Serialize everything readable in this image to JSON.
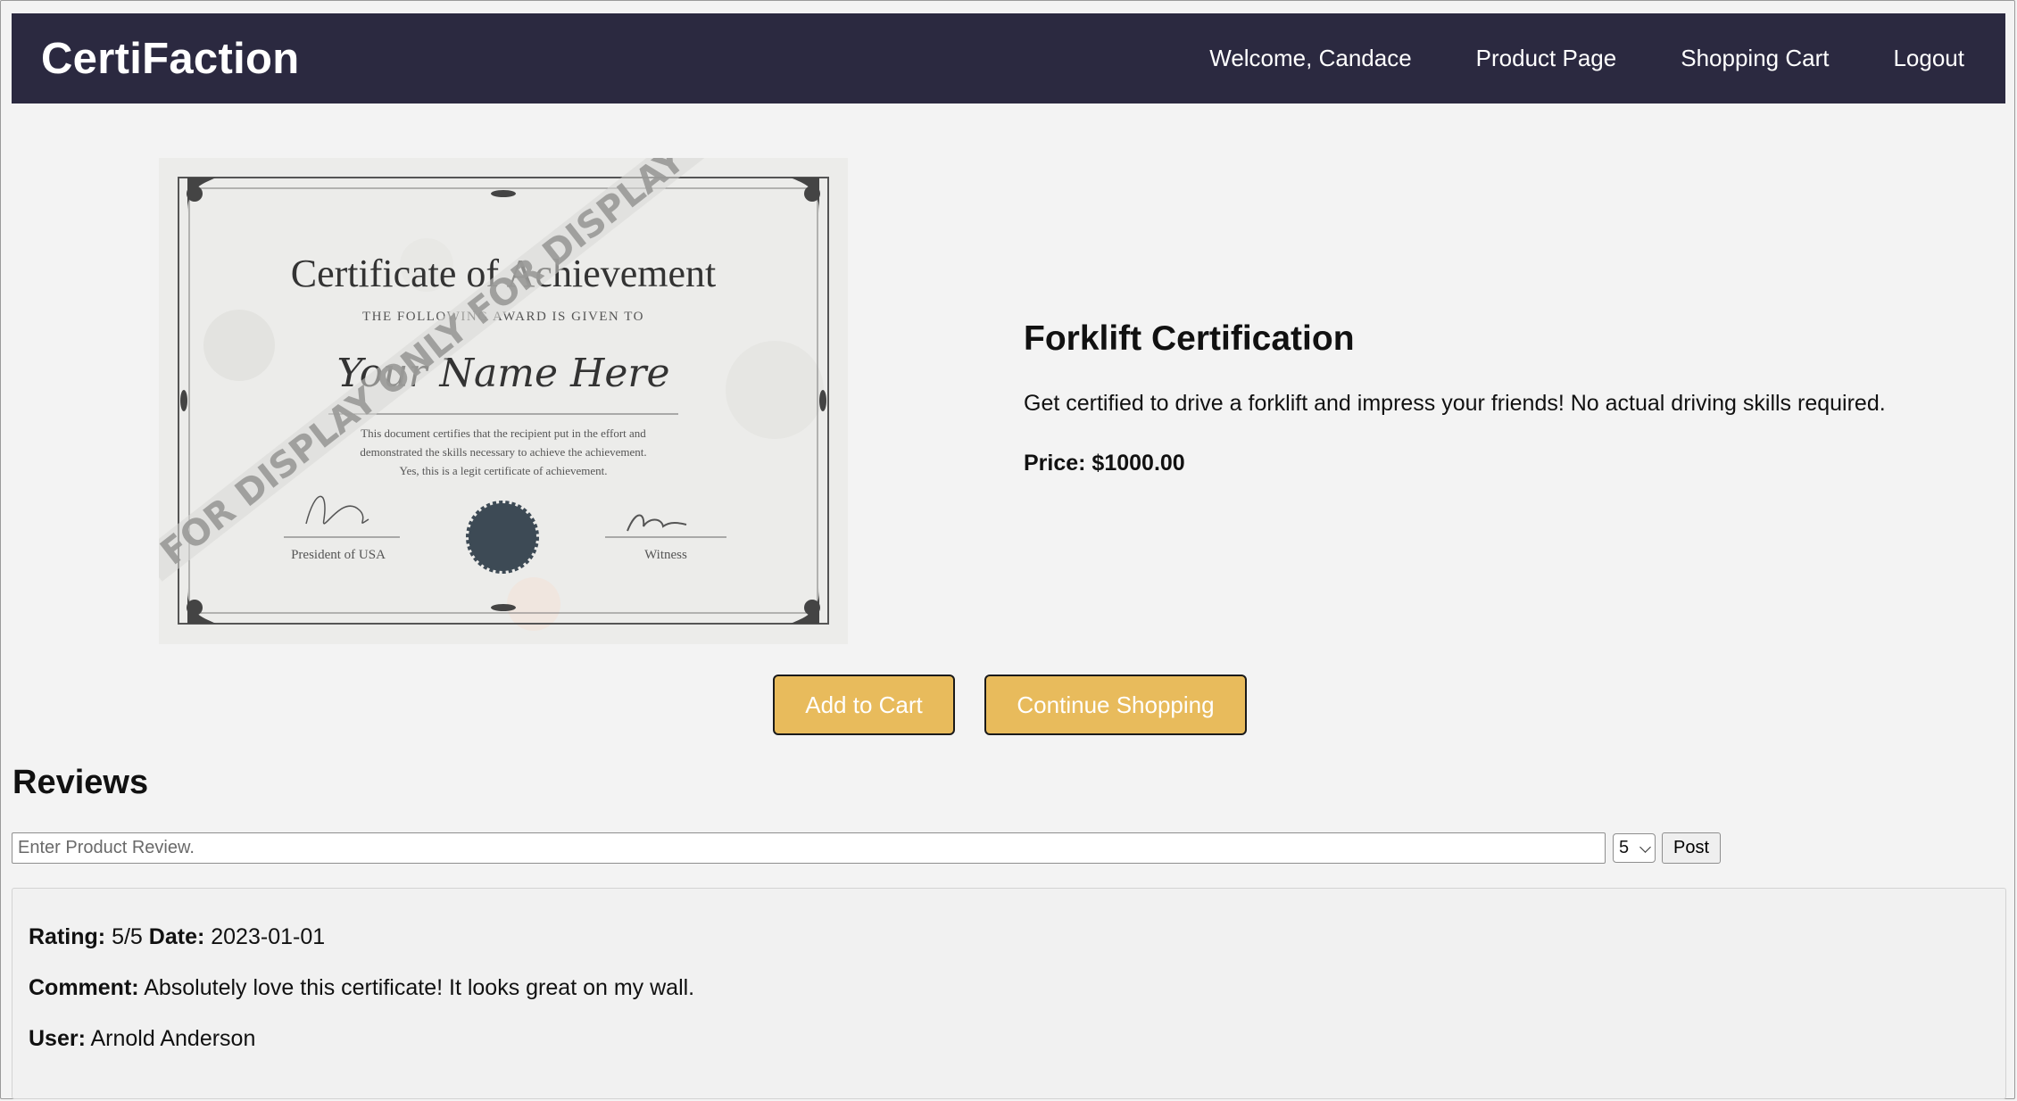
{
  "nav": {
    "brand": "CertiFaction",
    "welcome": "Welcome, Candace",
    "product_page": "Product Page",
    "shopping_cart": "Shopping Cart",
    "logout": "Logout"
  },
  "product": {
    "title": "Forklift Certification",
    "description": "Get certified to drive a forklift and impress your friends! No actual driving skills required.",
    "price": "Price: $1000.00",
    "image": {
      "heading": "Certificate of Achievement",
      "subheading": "THE FOLLOWING AWARD IS GIVEN TO",
      "name": "Your Name Here",
      "body_line1": "This document certifies that the recipient put in the effort and",
      "body_line2": "demonstrated the skills necessary to achieve the achievement.",
      "body_line3": "Yes, this is a legit certificate of achievement.",
      "sig_left": "President of USA",
      "sig_right": "Witness",
      "watermark": "FOR DISPLAY ONLY  FOR DISPLAY O"
    }
  },
  "actions": {
    "add_to_cart": "Add to Cart",
    "continue_shopping": "Continue Shopping"
  },
  "reviews": {
    "title": "Reviews",
    "input_placeholder": "Enter Product Review.",
    "rating_selected": "5",
    "post_label": "Post",
    "items": [
      {
        "rating_label": "Rating:",
        "rating_value": "5/5",
        "date_label": "Date:",
        "date_value": "2023-01-01",
        "comment_label": "Comment:",
        "comment_value": "Absolutely love this certificate! It looks great on my wall.",
        "user_label": "User:",
        "user_value": "Arnold Anderson"
      }
    ]
  },
  "colors": {
    "navbar": "#2b2940",
    "button_gold": "#e8bb5c",
    "page_bg": "#f3f3f3"
  }
}
